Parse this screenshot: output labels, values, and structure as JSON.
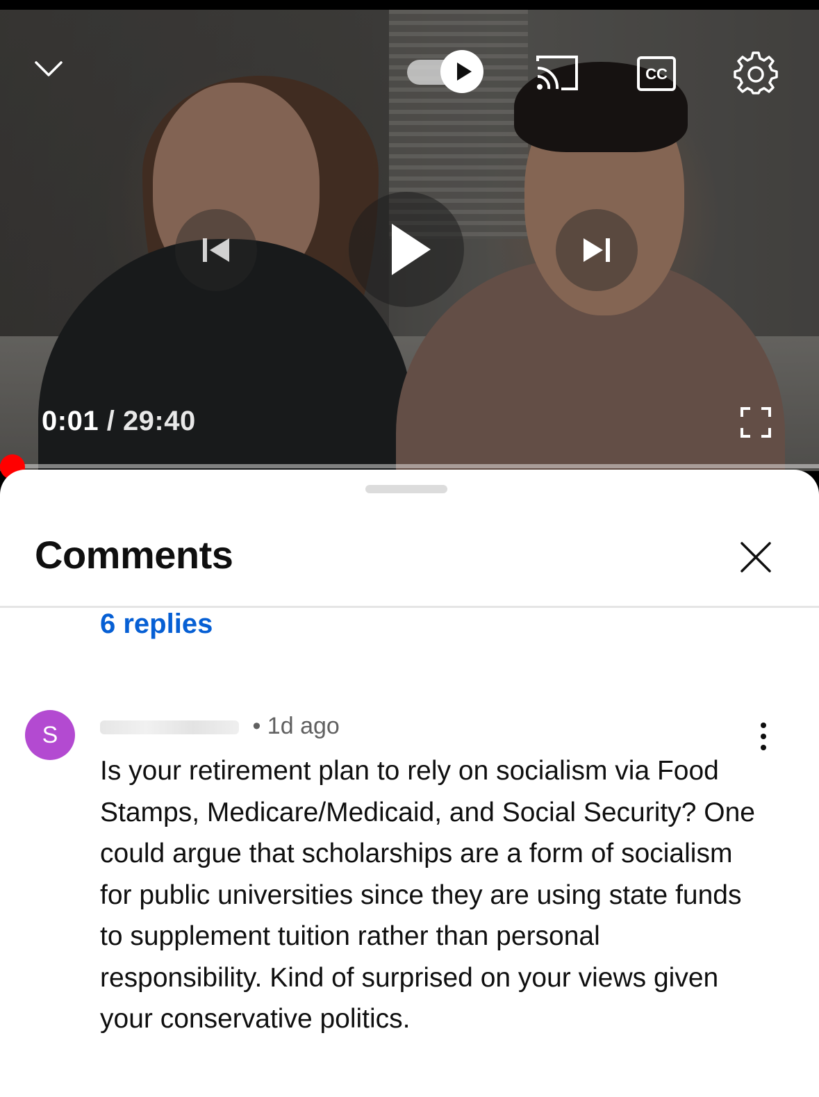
{
  "player": {
    "current_time": "0:01",
    "separator": "/",
    "duration": "29:40",
    "progress_fraction": 0.0006,
    "accent_color": "#ff0000",
    "icons": [
      "chevron-down-icon",
      "autoplay-toggle",
      "cast-icon",
      "cc-icon",
      "gear-icon",
      "previous-icon",
      "play-icon",
      "next-icon",
      "fullscreen-icon"
    ]
  },
  "comments_panel": {
    "title": "Comments",
    "replies_link": "6 replies",
    "comment": {
      "avatar_letter": "S",
      "avatar_color": "#b34ad1",
      "timestamp": "• 1d ago",
      "text": "Is your retirement plan to rely on socialism via Food Stamps, Medicare/Medicaid, and Social Security? One could argue that scholarships are a form of socialism for public universities since they are using state funds to supplement tuition rather than personal responsibility. Kind of surprised on your views given your conservative politics."
    },
    "link_color": "#065fd4"
  }
}
